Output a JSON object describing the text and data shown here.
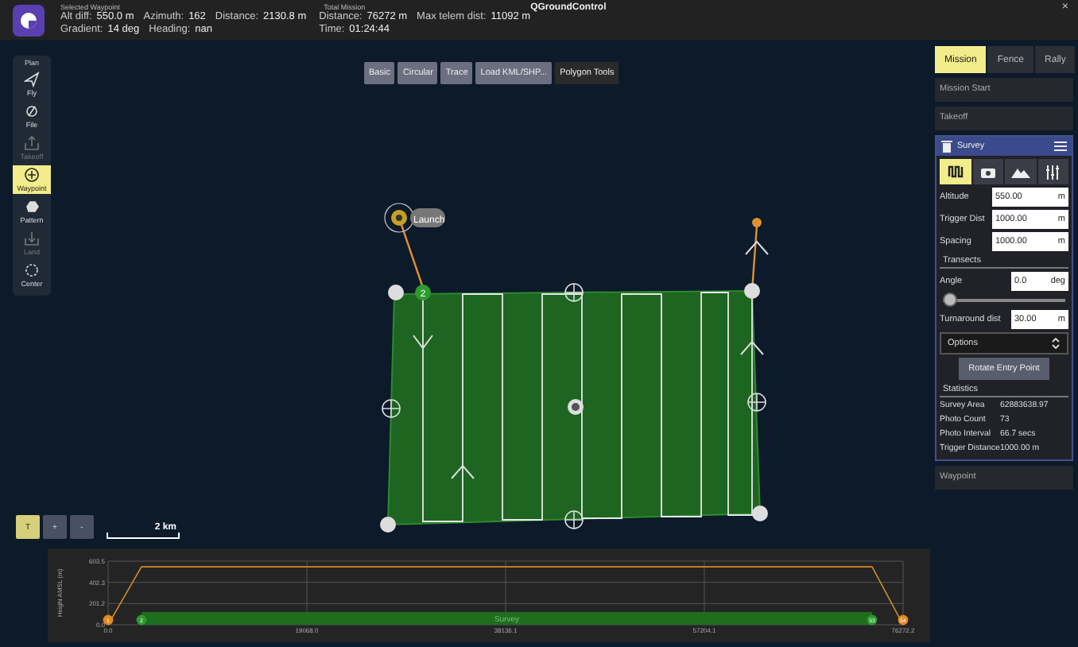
{
  "window": {
    "title": "QGroundControl",
    "close": "×"
  },
  "info_bar": {
    "groups": [
      {
        "title": "Selected Waypoint",
        "rows": [
          [
            {
              "label": "Alt diff:",
              "value": "550.0 m"
            },
            {
              "label": "Azimuth:",
              "value": "162"
            },
            {
              "label": "Distance:",
              "value": "2130.8 m"
            }
          ],
          [
            {
              "label": "Gradient:",
              "value": "14 deg"
            },
            {
              "label": "Heading:",
              "value": "nan"
            }
          ]
        ]
      },
      {
        "title": "Total Mission",
        "rows": [
          [
            {
              "label": "Distance:",
              "value": "76272 m"
            },
            {
              "label": "Max telem dist:",
              "value": "11092 m"
            }
          ],
          [
            {
              "label": "Time:",
              "value": "01:24:44"
            }
          ]
        ]
      }
    ]
  },
  "plan_toolbar": {
    "title": "Plan",
    "items": [
      {
        "label": "Fly",
        "selected": false,
        "disabled": false
      },
      {
        "label": "File",
        "selected": false,
        "disabled": false
      },
      {
        "label": "Takeoff",
        "selected": false,
        "disabled": true
      },
      {
        "label": "Waypoint",
        "selected": true,
        "disabled": false
      },
      {
        "label": "Pattern",
        "selected": false,
        "disabled": false
      },
      {
        "label": "Land",
        "selected": false,
        "disabled": true
      },
      {
        "label": "Center",
        "selected": false,
        "disabled": false
      }
    ]
  },
  "polygon_tools": {
    "buttons": [
      "Basic",
      "Circular",
      "Trace",
      "Load KML/SHP..."
    ],
    "title": "Polygon Tools"
  },
  "map": {
    "launch_label": "Launch",
    "waypoint_label": "2",
    "scale": "2 km",
    "zoom_buttons": [
      {
        "label": "T",
        "selected": true
      },
      {
        "label": "+",
        "selected": false
      },
      {
        "label": "-",
        "selected": false
      }
    ]
  },
  "mission_panel": {
    "tabs": [
      {
        "label": "Mission",
        "selected": true
      },
      {
        "label": "Fence",
        "selected": false
      },
      {
        "label": "Rally",
        "selected": false
      }
    ],
    "items_before": [
      "Mission Start",
      "Takeoff"
    ],
    "survey": {
      "title": "Survey",
      "icon_tabs": [
        {
          "selected": true
        },
        {
          "selected": false
        },
        {
          "selected": false
        },
        {
          "selected": false
        }
      ],
      "fields": [
        {
          "label": "Altitude",
          "value": "550.00",
          "unit": "m"
        },
        {
          "label": "Trigger Dist",
          "value": "1000.00",
          "unit": "m"
        },
        {
          "label": "Spacing",
          "value": "1000.00",
          "unit": "m"
        }
      ],
      "transects_title": "Transects",
      "angle": {
        "label": "Angle",
        "value": "0.0",
        "unit": "deg",
        "level": 0
      },
      "turnaround": {
        "label": "Turnaround dist",
        "value": "30.00",
        "unit": "m"
      },
      "options": "Options",
      "rotate_button": "Rotate Entry Point",
      "statistics_title": "Statistics",
      "statistics": [
        {
          "label": "Survey Area",
          "value": "62883638.97"
        },
        {
          "label": "Photo Count",
          "value": "73"
        },
        {
          "label": "Photo Interval",
          "value": "66.7 secs"
        },
        {
          "label": "Trigger Distance",
          "value": "1000.00 m"
        }
      ]
    },
    "items_after": [
      "Waypoint"
    ]
  },
  "profile": {
    "chart_data": {
      "type": "line",
      "ylabel": "Height AMSL (m)",
      "x": [
        0,
        3200,
        73300,
        76272.2
      ],
      "series": [
        {
          "color": "#d08a2a",
          "values": [
            0,
            550,
            550,
            0
          ]
        }
      ],
      "grid": true,
      "bands": [
        {
          "axis": "x",
          "from": 3200,
          "to": 73300,
          "label": "Survey",
          "color": "#1e6e1e"
        }
      ],
      "xlim": [
        0,
        76272.2
      ],
      "ylim": [
        0,
        603.5
      ],
      "xticks": [
        {
          "value": 0,
          "label": "0.0"
        },
        {
          "value": 19068,
          "label": "19068.0"
        },
        {
          "value": 38136.1,
          "label": "38136.1"
        },
        {
          "value": 57204.1,
          "label": "57204.1"
        },
        {
          "value": 76272.2,
          "label": "76272.2"
        }
      ],
      "yticks": [
        {
          "value": 0,
          "label": "0.0"
        },
        {
          "value": 201.2,
          "label": "201.2"
        },
        {
          "value": 402.3,
          "label": "402.3"
        },
        {
          "value": 603.5,
          "label": "603.5"
        }
      ]
    },
    "markers": [
      {
        "label": "1",
        "color": "#e08a1e"
      },
      {
        "label": "2",
        "color": "#2e9a2e"
      },
      {
        "label": "53",
        "color": "#2e9a2e"
      },
      {
        "label": "54",
        "color": "#e08a1e"
      }
    ]
  }
}
